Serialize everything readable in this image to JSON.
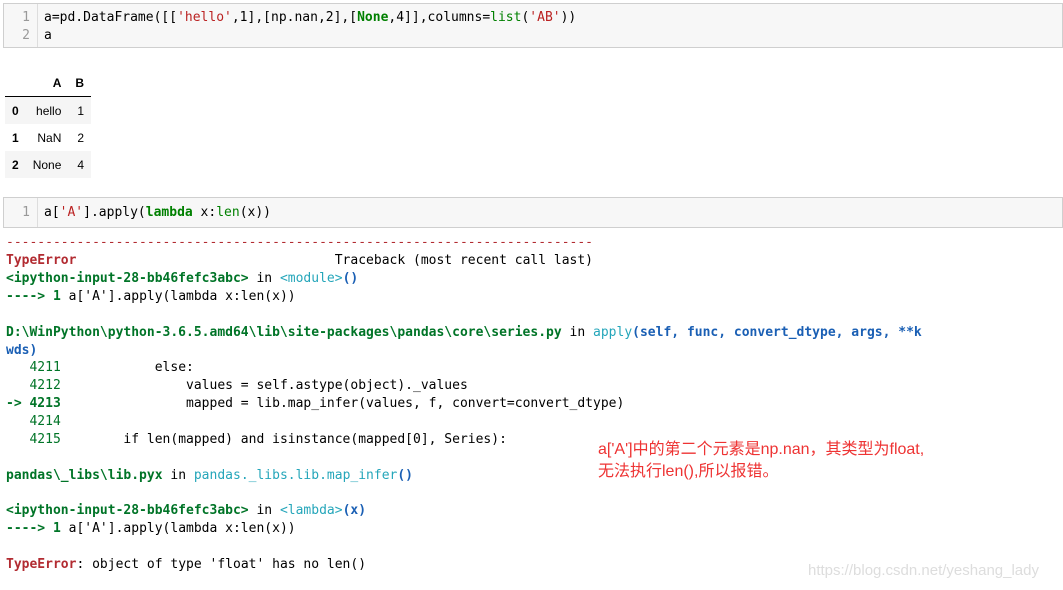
{
  "cell1": {
    "line_numbers": [
      "1",
      "2"
    ],
    "line1_parts": [
      "a=pd.DataFrame([[",
      "'hello'",
      ",1],[np.nan,2],[",
      "None",
      ",4]],columns=",
      "list",
      "(",
      "'AB'",
      "))"
    ],
    "line2": "a"
  },
  "dataframe": {
    "columns": [
      "",
      "A",
      "B"
    ],
    "rows": [
      {
        "index": "0",
        "A": "hello",
        "B": "1"
      },
      {
        "index": "1",
        "A": "NaN",
        "B": "2"
      },
      {
        "index": "2",
        "A": "None",
        "B": "4"
      }
    ]
  },
  "cell2": {
    "line_number": "1",
    "parts": [
      "a[",
      "'A'",
      "].apply(",
      "lambda",
      " x:",
      "len",
      "(x))"
    ]
  },
  "traceback": {
    "dashes": "---------------------------------------------------------------------------",
    "error_type": "TypeError",
    "traceback_header": "                                 Traceback (most recent call last)",
    "input1": "<ipython-input-28-bb46fefc3abc>",
    "in": " in ",
    "module": "<module>",
    "module_paren": "()",
    "arrow_line1_prefix": "----> 1 ",
    "arrow_line1_code": "a['A'].apply(lambda x:len(x))",
    "file_path": "D:\\WinPython\\python-3.6.5.amd64\\lib\\site-packages\\pandas\\core\\series.py",
    "apply_fn": "apply",
    "apply_sig": "(self, func, convert_dtype, args, **k",
    "apply_sig_cont": "wds)",
    "src_lines": [
      {
        "no": "   4211",
        "code": "            else:"
      },
      {
        "no": "   4212",
        "code": "                values = self.astype(object)._values"
      },
      {
        "no": "-> 4213",
        "code": "                mapped = lib.map_infer(values, f, convert=convert_dtype)"
      },
      {
        "no": "   4214",
        "code": ""
      },
      {
        "no": "   4215",
        "code": "        if len(mapped) and isinstance(mapped[0], Series):"
      }
    ],
    "lib_path": "pandas\\_libs\\lib.pyx",
    "lib_fn": "pandas._libs.lib.map_infer",
    "lib_paren": "()",
    "input2": "<ipython-input-28-bb46fefc3abc>",
    "lambda_fn": "<lambda>",
    "lambda_paren": "(x)",
    "arrow_line2_prefix": "----> 1 ",
    "arrow_line2_code": "a['A'].apply(lambda x:len(x))",
    "final_error_type": "TypeError",
    "final_error_msg": ": object of type 'float' has no len()"
  },
  "annotation": {
    "line1": "a['A']中的第二个元素是np.nan，其类型为float,",
    "line2": "无法执行len(),所以报错。"
  },
  "watermark": "https://blog.csdn.net/yeshang_lady"
}
